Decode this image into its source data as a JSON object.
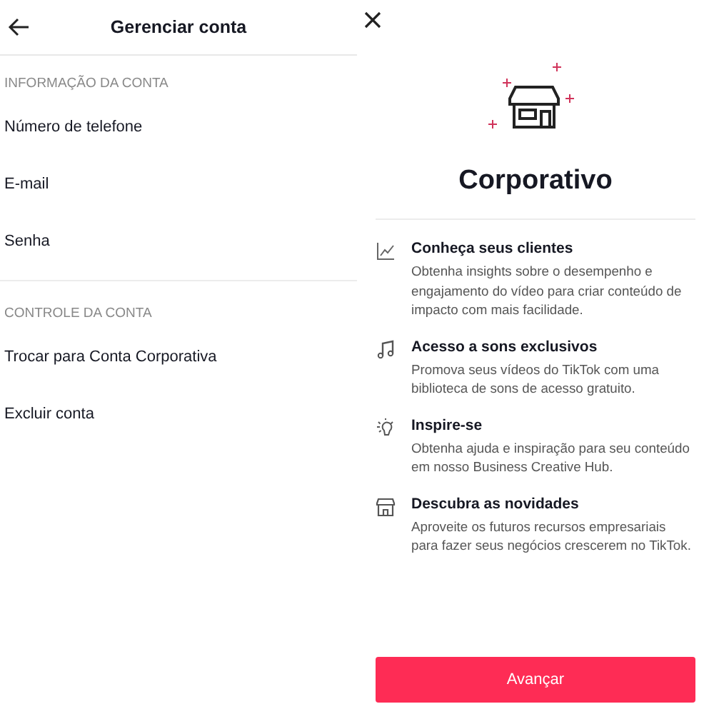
{
  "account_screen": {
    "title": "Gerenciar conta",
    "sections": [
      {
        "heading": "INFORMAÇÃO DA CONTA",
        "items": [
          "Número de telefone",
          "E-mail",
          "Senha"
        ]
      },
      {
        "heading": "CONTROLE DA CONTA",
        "items": [
          "Trocar para Conta Corporativa",
          "Excluir conta"
        ]
      }
    ]
  },
  "business_screen": {
    "title": "Corporativo",
    "features": [
      {
        "kind": "chart",
        "title": "Conheça seus clientes",
        "description": "Obtenha insights sobre o desempenho e engajamento do vídeo para criar conteúdo de impacto com mais facilidade."
      },
      {
        "kind": "music",
        "title": "Acesso a sons exclusivos",
        "description": "Promova seus vídeos do TikTok com uma biblioteca de sons de acesso gratuito."
      },
      {
        "kind": "bulb",
        "title": "Inspire-se",
        "description": "Obtenha ajuda e inspiração para seu conteúdo em nosso Business Creative Hub."
      },
      {
        "kind": "store",
        "title": "Descubra as novidades",
        "description": "Aproveite os futuros recursos empresariais para fazer seus negócios crescerem no TikTok."
      }
    ],
    "button": "Avançar"
  }
}
